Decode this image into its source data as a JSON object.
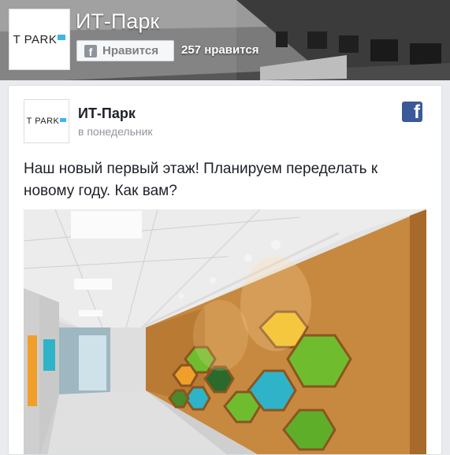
{
  "header": {
    "page_title": "ИТ-Парк",
    "logo_text": "T PARK",
    "like_button_label": "Нравится",
    "like_count": "257 нравится"
  },
  "post": {
    "author": "ИТ-Парк",
    "timestamp": "в понедельник",
    "text": "Наш новый первый этаж! Планируем переделать к новому году. Как вам?",
    "avatar_logo_text": "T PARK"
  },
  "colors": {
    "facebook_blue": "#3b5998",
    "hex_yellow": "#f2c01e",
    "hex_green": "#6fbd2e",
    "hex_teal": "#2fb3c9",
    "hex_orange": "#f0a02a",
    "wood": "#c7893f"
  },
  "icons": {
    "like_button_icon": "facebook-f-icon",
    "post_network_icon": "facebook-icon"
  }
}
